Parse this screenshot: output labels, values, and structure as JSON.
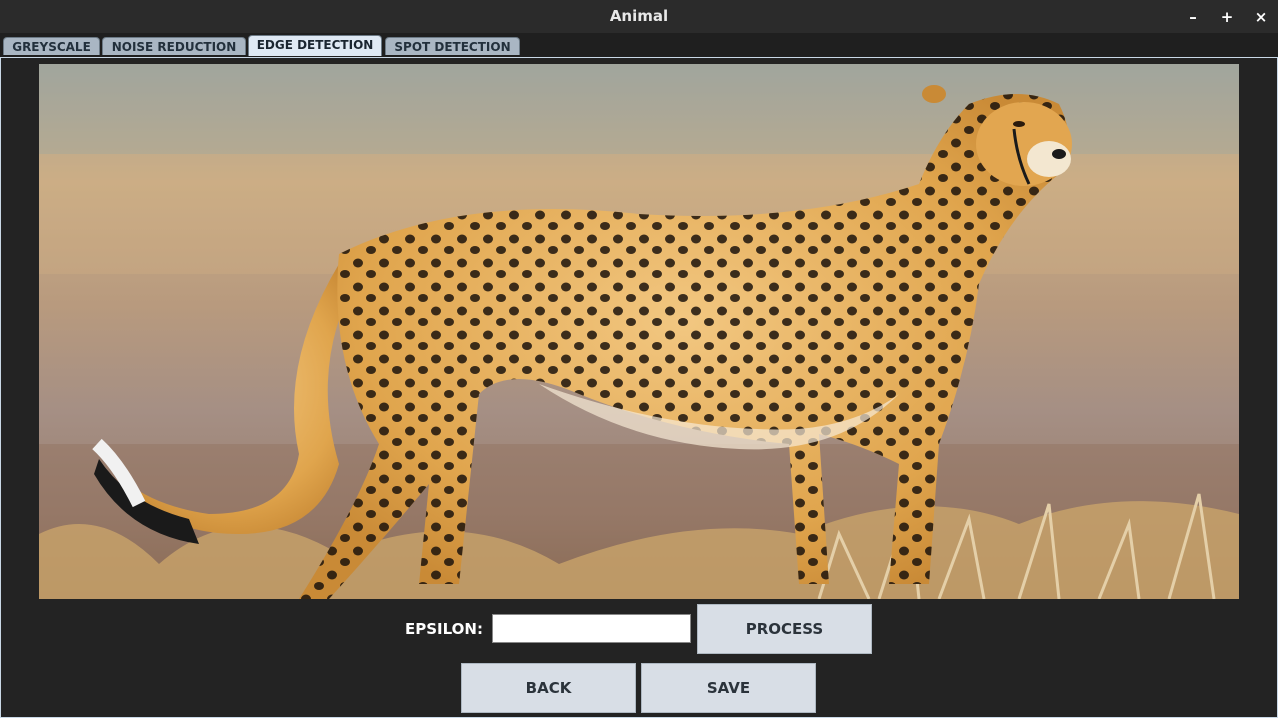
{
  "window": {
    "title": "Animal",
    "minimize": "–",
    "maximize": "+",
    "close": "×"
  },
  "tabs": [
    {
      "label": "GREYSCALE",
      "active": false
    },
    {
      "label": "NOISE REDUCTION",
      "active": false
    },
    {
      "label": "EDGE DETECTION",
      "active": true
    },
    {
      "label": "SPOT DETECTION",
      "active": false
    }
  ],
  "image": {
    "subject": "cheetah"
  },
  "controls": {
    "epsilon_label": "EPSILON:",
    "epsilon_value": "",
    "process_label": "PROCESS",
    "back_label": "BACK",
    "save_label": "SAVE"
  },
  "colors": {
    "window_bg": "#1f1f1f",
    "tab_active": "#dfe9f4",
    "tab_inactive": "#a9b6c3",
    "button_bg": "#d8dee6"
  }
}
